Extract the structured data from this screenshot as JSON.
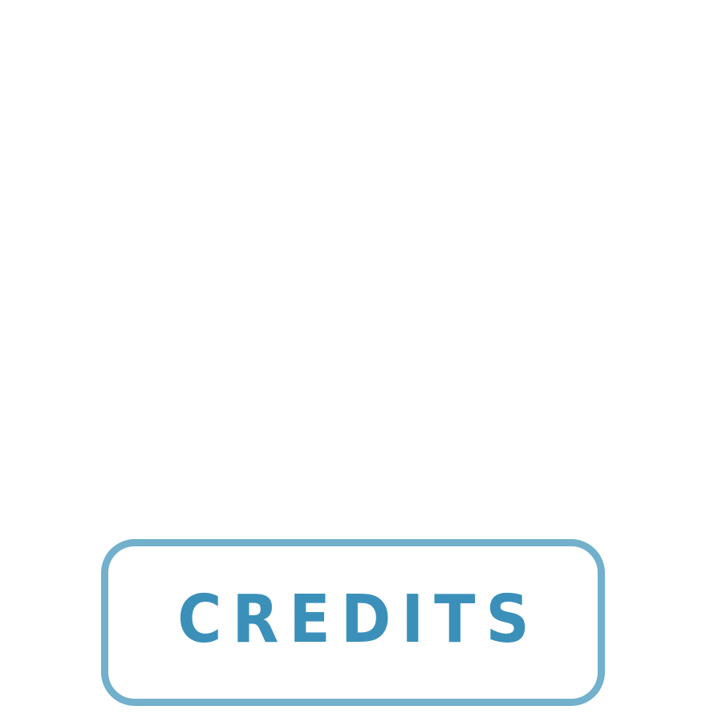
{
  "credits_button": {
    "label": "CREDITS",
    "text_color": "#3b90ba",
    "border_color": "#72b0cc",
    "background_color": "#ffffff"
  },
  "page": {
    "background_color": "#ffffff"
  }
}
